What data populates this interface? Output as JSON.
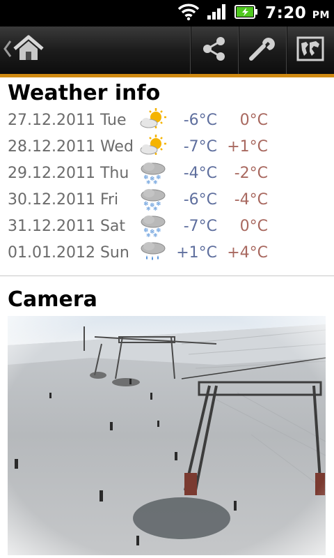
{
  "status_bar": {
    "time": "7:20",
    "ampm": "PM",
    "icons": [
      "wifi-icon",
      "signal-icon",
      "battery-charging-icon"
    ]
  },
  "action_bar": {
    "home_icon": "home-icon",
    "buttons": [
      "share-icon",
      "wrench-icon",
      "map-icon"
    ],
    "accent_color": "#d08a12"
  },
  "weather": {
    "title": "Weather info",
    "rows": [
      {
        "date": "27.12.2011 Tue",
        "icon": "sunny-cloud-icon",
        "low": "-6°C",
        "high": "0°C"
      },
      {
        "date": "28.12.2011 Wed",
        "icon": "sunny-cloud-icon",
        "low": "-7°C",
        "high": "+1°C"
      },
      {
        "date": "29.12.2011 Thu",
        "icon": "snow-cloud-icon",
        "low": "-4°C",
        "high": "-2°C"
      },
      {
        "date": "30.12.2011 Fri",
        "icon": "snow-cloud-icon",
        "low": "-6°C",
        "high": "-4°C"
      },
      {
        "date": "31.12.2011 Sat",
        "icon": "snow-cloud-icon",
        "low": "-7°C",
        "high": "0°C"
      },
      {
        "date": "01.01.2012 Sun",
        "icon": "rain-cloud-icon",
        "low": "+1°C",
        "high": "+4°C"
      }
    ],
    "low_color": "#5f6f9e",
    "high_color": "#a8685f"
  },
  "camera": {
    "title": "Camera"
  }
}
